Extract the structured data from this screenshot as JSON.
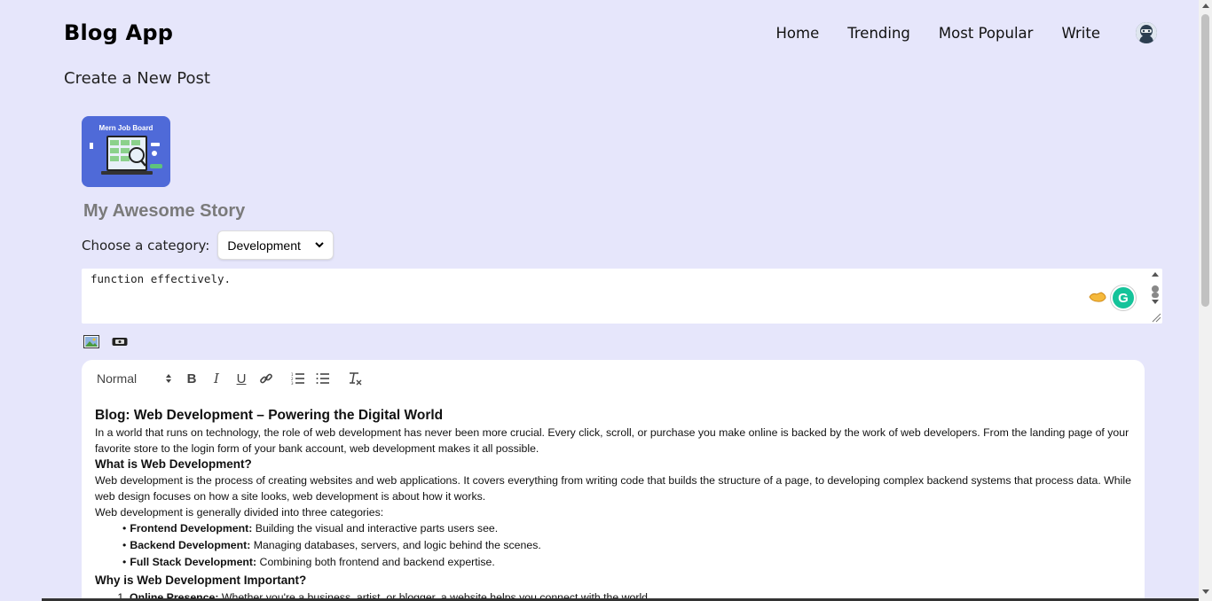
{
  "header": {
    "brand": "Blog App",
    "nav": [
      "Home",
      "Trending",
      "Most Popular",
      "Write"
    ]
  },
  "page_heading": "Create a New Post",
  "thumbnail": {
    "title": "Mern Job Board"
  },
  "post": {
    "title": "My Awesome Story",
    "category_label": "Choose a category:",
    "category_value": "Development",
    "description": "function effectively."
  },
  "editor": {
    "format": "Normal",
    "content": {
      "h1": "Blog: Web Development – Powering the Digital World",
      "p1": "In a world that runs on technology, the role of web development has never been more crucial. Every click, scroll, or purchase you make online is backed by the work of web developers. From the landing page of your favorite store to the login form of your bank account, web development makes it all possible.",
      "h2_what": "What is Web Development?",
      "p2": "Web development is the process of creating websites and web applications. It covers everything from writing code that builds the structure of a page, to developing complex backend systems that process data. While web design focuses on how a site looks, web development is about how it works.",
      "p3": "Web development is generally divided into three categories:",
      "list": [
        {
          "bold": "Frontend Development:",
          "text": " Building the visual and interactive parts users see."
        },
        {
          "bold": "Backend Development:",
          "text": " Managing databases, servers, and logic behind the scenes."
        },
        {
          "bold": "Full Stack Development:",
          "text": " Combining both frontend and backend expertise."
        }
      ],
      "h2_why": "Why is Web Development Important?",
      "ol_first": {
        "bold": "Online Presence:",
        "text": " Whether you're a business, artist, or blogger, a website helps you connect with the world."
      }
    }
  },
  "colors": {
    "background": "#e6e6fb",
    "grammarly": "#15c39a"
  }
}
